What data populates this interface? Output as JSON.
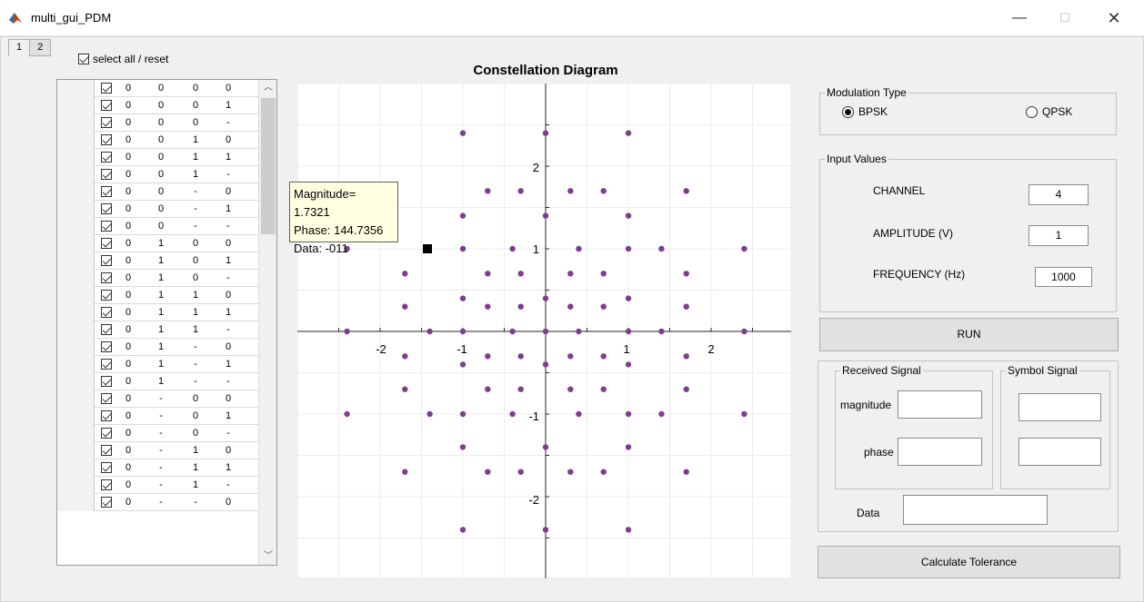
{
  "window": {
    "title": "multi_gui_PDM",
    "minimize": "—",
    "maximize": "☐",
    "close": "✕"
  },
  "tabs": [
    "1",
    "2"
  ],
  "select_all": {
    "label": "select all / reset"
  },
  "table": {
    "rows": [
      [
        "0",
        "0",
        "0",
        "0"
      ],
      [
        "0",
        "0",
        "0",
        "1"
      ],
      [
        "0",
        "0",
        "0",
        "-"
      ],
      [
        "0",
        "0",
        "1",
        "0"
      ],
      [
        "0",
        "0",
        "1",
        "1"
      ],
      [
        "0",
        "0",
        "1",
        "-"
      ],
      [
        "0",
        "0",
        "-",
        "0"
      ],
      [
        "0",
        "0",
        "-",
        "1"
      ],
      [
        "0",
        "0",
        "-",
        "-"
      ],
      [
        "0",
        "1",
        "0",
        "0"
      ],
      [
        "0",
        "1",
        "0",
        "1"
      ],
      [
        "0",
        "1",
        "0",
        "-"
      ],
      [
        "0",
        "1",
        "1",
        "0"
      ],
      [
        "0",
        "1",
        "1",
        "1"
      ],
      [
        "0",
        "1",
        "1",
        "-"
      ],
      [
        "0",
        "1",
        "-",
        "0"
      ],
      [
        "0",
        "1",
        "-",
        "1"
      ],
      [
        "0",
        "1",
        "-",
        "-"
      ],
      [
        "0",
        "-",
        "0",
        "0"
      ],
      [
        "0",
        "-",
        "0",
        "1"
      ],
      [
        "0",
        "-",
        "0",
        "-"
      ],
      [
        "0",
        "-",
        "1",
        "0"
      ],
      [
        "0",
        "-",
        "1",
        "1"
      ],
      [
        "0",
        "-",
        "1",
        "-"
      ],
      [
        "0",
        "-",
        "-",
        "0"
      ]
    ]
  },
  "plot": {
    "title": "Constellation Diagram",
    "tick_labels_x": [
      "-2",
      "-1",
      "1",
      "2"
    ],
    "tick_labels_y": [
      "2",
      "1",
      "-1",
      "-2"
    ],
    "tooltip": {
      "magnitude": "Magnitude= 1.7321",
      "phase": "Phase: 144.7356",
      "data": "Data: -011"
    }
  },
  "chart_data": {
    "type": "scatter",
    "title": "Constellation Diagram",
    "xlabel": "",
    "ylabel": "",
    "xlim": [
      -3.0,
      3.0
    ],
    "ylim": [
      -3.0,
      3.0
    ],
    "grid": true,
    "color": "#7e3d8e",
    "points": [
      [
        -1,
        2.4
      ],
      [
        0,
        2.4
      ],
      [
        1,
        2.4
      ],
      [
        -0.7,
        1.7
      ],
      [
        -0.3,
        1.7
      ],
      [
        0.3,
        1.7
      ],
      [
        0.7,
        1.7
      ],
      [
        1.7,
        1.7
      ],
      [
        -1,
        1.4
      ],
      [
        0,
        1.4
      ],
      [
        1,
        1.4
      ],
      [
        -2.4,
        1
      ],
      [
        -1,
        1
      ],
      [
        -0.4,
        1
      ],
      [
        0.4,
        1
      ],
      [
        1,
        1
      ],
      [
        1.4,
        1
      ],
      [
        2.4,
        1
      ],
      [
        -1.7,
        0.7
      ],
      [
        -0.7,
        0.7
      ],
      [
        -0.3,
        0.7
      ],
      [
        0.3,
        0.7
      ],
      [
        0.7,
        0.7
      ],
      [
        1.7,
        0.7
      ],
      [
        -1,
        0.4
      ],
      [
        0,
        0.4
      ],
      [
        1,
        0.4
      ],
      [
        -1.7,
        0.3
      ],
      [
        -0.7,
        0.3
      ],
      [
        -0.3,
        0.3
      ],
      [
        0.3,
        0.3
      ],
      [
        0.7,
        0.3
      ],
      [
        1.7,
        0.3
      ],
      [
        -2.4,
        0
      ],
      [
        -1.4,
        0
      ],
      [
        -1,
        0
      ],
      [
        -0.4,
        0
      ],
      [
        0,
        0
      ],
      [
        0.4,
        0
      ],
      [
        1,
        0
      ],
      [
        1.4,
        0
      ],
      [
        2.4,
        0
      ],
      [
        -1.7,
        -0.3
      ],
      [
        -0.7,
        -0.3
      ],
      [
        -0.3,
        -0.3
      ],
      [
        0.3,
        -0.3
      ],
      [
        0.7,
        -0.3
      ],
      [
        1.7,
        -0.3
      ],
      [
        -1,
        -0.4
      ],
      [
        0,
        -0.4
      ],
      [
        1,
        -0.4
      ],
      [
        -1.7,
        -0.7
      ],
      [
        -0.7,
        -0.7
      ],
      [
        -0.3,
        -0.7
      ],
      [
        0.3,
        -0.7
      ],
      [
        0.7,
        -0.7
      ],
      [
        1.7,
        -0.7
      ],
      [
        -2.4,
        -1
      ],
      [
        -1.4,
        -1
      ],
      [
        -1,
        -1
      ],
      [
        -0.4,
        -1
      ],
      [
        0.4,
        -1
      ],
      [
        1,
        -1
      ],
      [
        1.4,
        -1
      ],
      [
        2.4,
        -1
      ],
      [
        -1,
        -1.4
      ],
      [
        0,
        -1.4
      ],
      [
        1,
        -1.4
      ],
      [
        -1.7,
        -1.7
      ],
      [
        -0.7,
        -1.7
      ],
      [
        -0.3,
        -1.7
      ],
      [
        0.3,
        -1.7
      ],
      [
        0.7,
        -1.7
      ],
      [
        1.7,
        -1.7
      ],
      [
        -1,
        -2.4
      ],
      [
        0,
        -2.4
      ],
      [
        1,
        -2.4
      ]
    ],
    "selected_point": [
      -1.4,
      1
    ]
  },
  "modulation": {
    "title": "Modulation Type",
    "bpsk": "BPSK",
    "qpsk": "QPSK",
    "selected": "BPSK"
  },
  "inputs": {
    "title": "Input Values",
    "channel_label": "CHANNEL",
    "channel_value": "4",
    "amplitude_label": "AMPLITUDE (V)",
    "amplitude_value": "1",
    "frequency_label": "FREQUENCY (Hz)",
    "frequency_value": "1000"
  },
  "run_button": "RUN",
  "received": {
    "title": "Received Signal",
    "magnitude_label": "magnitude",
    "phase_label": "phase",
    "magnitude_value": "",
    "phase_value": ""
  },
  "symbol": {
    "title": "Symbol Signal",
    "value1": "",
    "value2": ""
  },
  "data_field": {
    "label": "Data",
    "value": ""
  },
  "tolerance_button": "Calculate Tolerance"
}
